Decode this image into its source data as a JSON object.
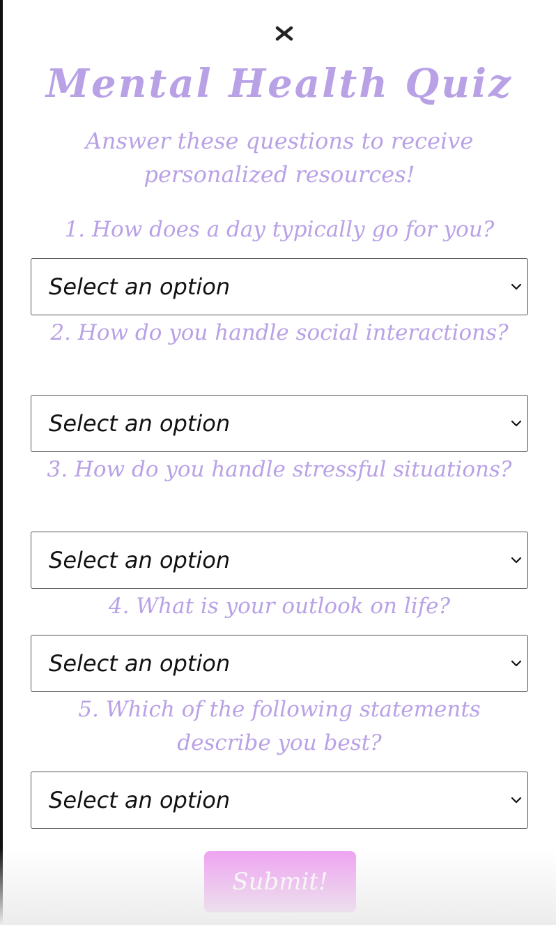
{
  "modal": {
    "close_icon": "close-icon",
    "title": "Mental Health Quiz",
    "subtitle": "Answer these questions to receive personalized resources!"
  },
  "questions": [
    {
      "label": "1. How does a day typically go for you?",
      "selected": "Select an option"
    },
    {
      "label": "2. How do you handle social interactions?",
      "selected": "Select an option"
    },
    {
      "label": "3. How do you handle stressful situations?",
      "selected": "Select an option"
    },
    {
      "label": "4. What is your outlook on life?",
      "selected": "Select an option"
    },
    {
      "label": "5. Which of the following statements describe you best?",
      "selected": "Select an option"
    }
  ],
  "submit_label": "Submit!",
  "colors": {
    "accent_text": "#b9a1e6",
    "submit_bg": "#eea2f1",
    "border": "#555555"
  }
}
